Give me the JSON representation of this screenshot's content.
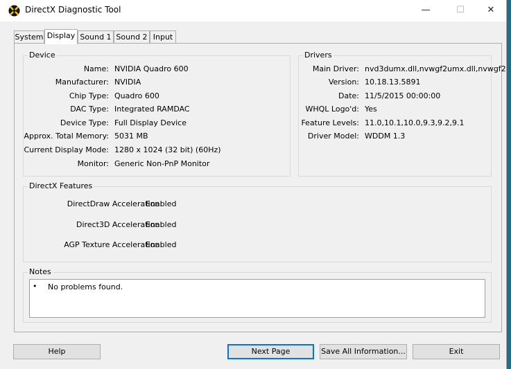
{
  "window": {
    "title": "DirectX Diagnostic Tool",
    "minimize": "—",
    "maximize": "☐",
    "close": "✕"
  },
  "tabs": [
    "System",
    "Display",
    "Sound 1",
    "Sound 2",
    "Input"
  ],
  "active_tab": "Display",
  "device": {
    "group_label": "Device",
    "rows": [
      {
        "label": "Name:",
        "value": "NVIDIA Quadro 600"
      },
      {
        "label": "Manufacturer:",
        "value": "NVIDIA"
      },
      {
        "label": "Chip Type:",
        "value": "Quadro 600"
      },
      {
        "label": "DAC Type:",
        "value": "Integrated RAMDAC"
      },
      {
        "label": "Device Type:",
        "value": "Full Display Device"
      },
      {
        "label": "Approx. Total Memory:",
        "value": "5031 MB"
      },
      {
        "label": "Current Display Mode:",
        "value": "1280 x 1024 (32 bit) (60Hz)"
      },
      {
        "label": "Monitor:",
        "value": "Generic Non-PnP Monitor"
      }
    ]
  },
  "drivers": {
    "group_label": "Drivers",
    "rows": [
      {
        "label": "Main Driver:",
        "value": "nvd3dumx.dll,nvwgf2umx.dll,nvwgf2"
      },
      {
        "label": "Version:",
        "value": "10.18.13.5891"
      },
      {
        "label": "Date:",
        "value": "11/5/2015 00:00:00"
      },
      {
        "label": "WHQL Logo'd:",
        "value": "Yes"
      },
      {
        "label": "Feature Levels:",
        "value": "11.0,10.1,10.0,9.3,9.2,9.1"
      },
      {
        "label": "Driver Model:",
        "value": "WDDM 1.3"
      }
    ]
  },
  "features": {
    "group_label": "DirectX Features",
    "rows": [
      {
        "label": "DirectDraw Acceleration:",
        "value": "Enabled"
      },
      {
        "label": "Direct3D Acceleration:",
        "value": "Enabled"
      },
      {
        "label": "AGP Texture Acceleration:",
        "value": "Enabled"
      }
    ]
  },
  "notes": {
    "group_label": "Notes",
    "bullet": "•",
    "text": "No problems found."
  },
  "buttons": {
    "help": "Help",
    "next_page": "Next Page",
    "save_all": "Save All Information...",
    "exit": "Exit"
  }
}
